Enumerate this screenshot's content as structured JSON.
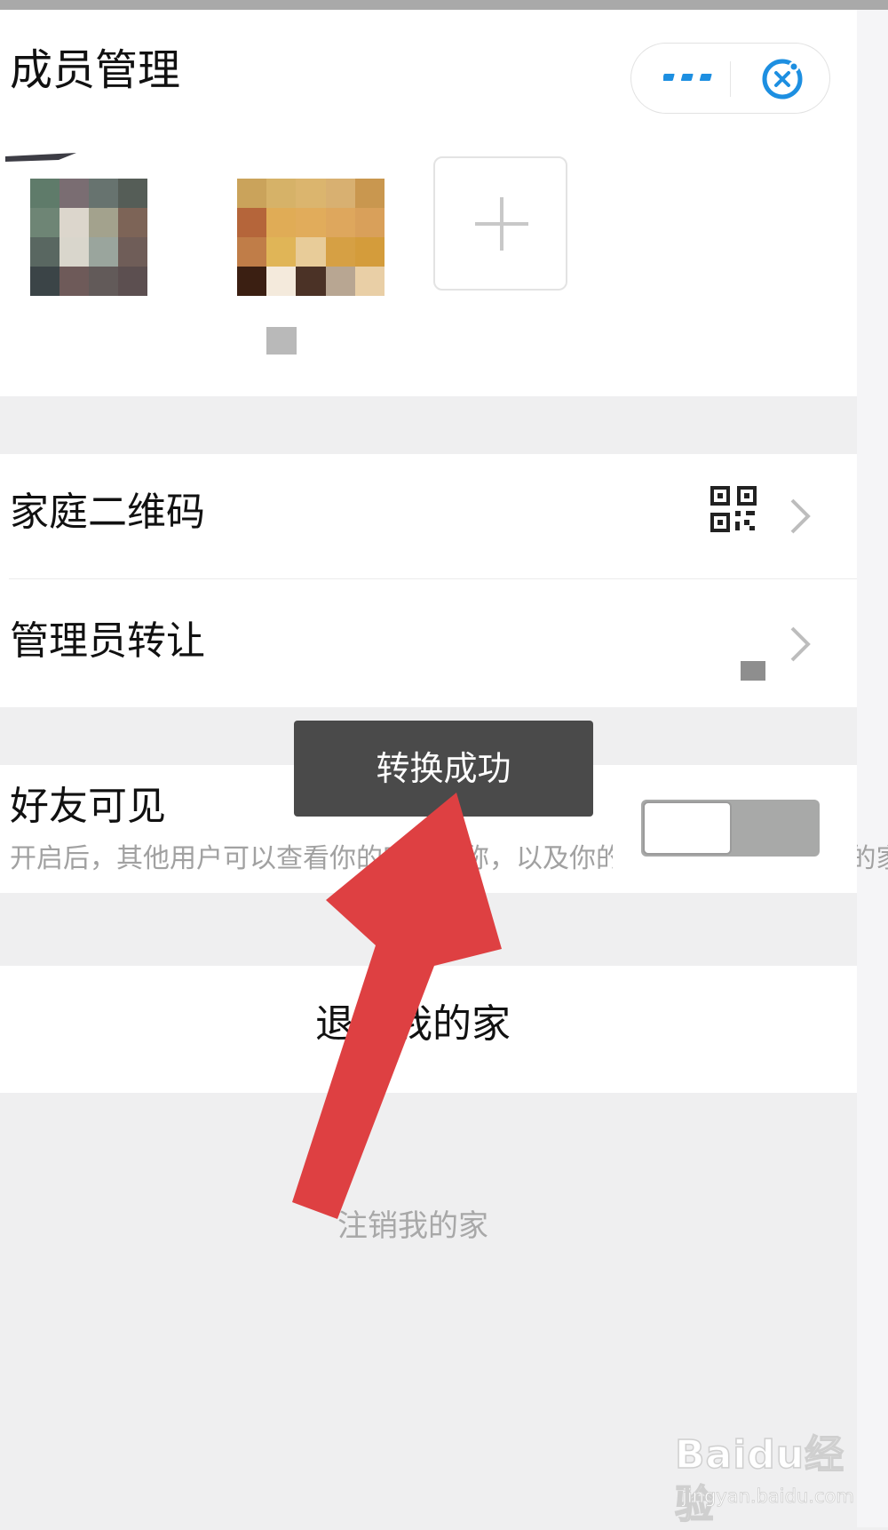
{
  "header": {
    "title": "成员管理"
  },
  "capsule": {
    "more_icon": "more-icon",
    "close_icon": "close-icon",
    "accent": "#1d8fe1"
  },
  "members": {
    "add_icon": "plus-icon",
    "tiles": [
      {
        "colors": [
          "#5f7b6a",
          "#7a6d72",
          "#67736f",
          "#555d57",
          "#6e8575",
          "#dcd6cc",
          "#a3a28d",
          "#7d6457",
          "#596761",
          "#d9d6cc",
          "#9aa59d",
          "#6f5d58",
          "#3b4447",
          "#6e5a59",
          "#625a59",
          "#5c4f50"
        ]
      },
      {
        "colors": [
          "#caa35b",
          "#d6b268",
          "#dbb56e",
          "#d8b071",
          "#c9974f",
          "#b5653a",
          "#e0ac56",
          "#e1ac5b",
          "#dea75d",
          "#d9a05a",
          "#c07d48",
          "#e0b557",
          "#e8cc99",
          "#d6a044",
          "#d49c3b",
          "#3b1f12",
          "#f4eadc",
          "#4b3226",
          "#b8a692",
          "#e9cfa6"
        ]
      }
    ]
  },
  "settings": {
    "qr_label": "家庭二维码",
    "qr_icon": "qr-code-icon",
    "transfer_label": "管理员转让",
    "chevron_icon": "chevron-right-icon",
    "friend_title": "好友可见",
    "friend_desc": "开启后，其他用户可以查看你的家的名称，以及你的头像，帮你走入“我的家”",
    "friend_toggle_on": false,
    "exit_label": "退出我的家",
    "cancel_label": "注销我的家"
  },
  "toast": {
    "text": "转换成功"
  },
  "annotation": {
    "type": "arrow",
    "color": "#de4042"
  },
  "watermark": {
    "brand": "Baidu经验",
    "url": "jingyan.baidu.com"
  }
}
